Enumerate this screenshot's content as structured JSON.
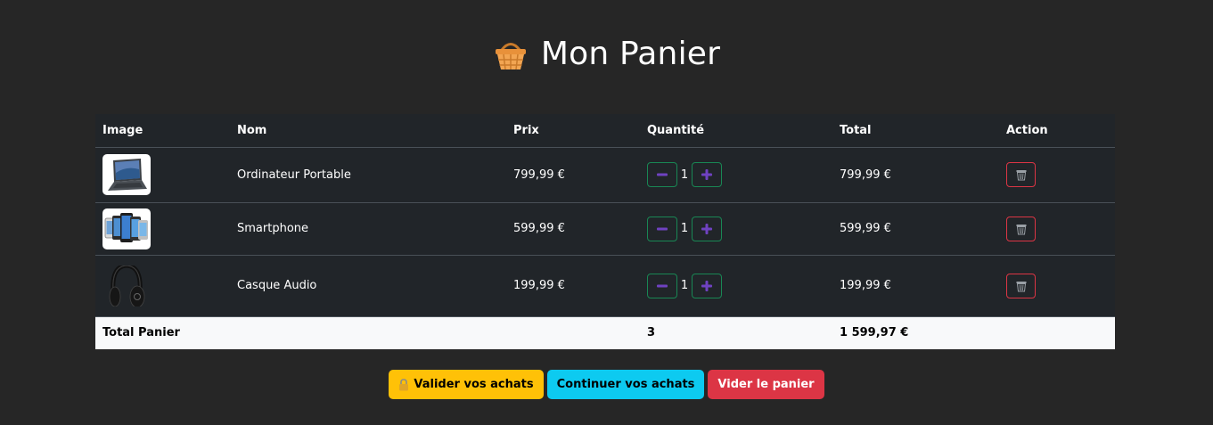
{
  "header": {
    "title": "Mon Panier",
    "icon": "basket-icon"
  },
  "table": {
    "columns": [
      "Image",
      "Nom",
      "Prix",
      "Quantité",
      "Total",
      "Action"
    ],
    "rows": [
      {
        "image": "laptop-image",
        "name": "Ordinateur Portable",
        "price": "799,99 €",
        "quantity": "1",
        "total": "799,99 €"
      },
      {
        "image": "smartphones-image",
        "name": "Smartphone",
        "price": "599,99 €",
        "quantity": "1",
        "total": "599,99 €"
      },
      {
        "image": "headphones-image",
        "name": "Casque Audio",
        "price": "199,99 €",
        "quantity": "1",
        "total": "199,99 €"
      }
    ],
    "footer": {
      "label": "Total Panier",
      "quantity": "3",
      "total": "1 599,97 €"
    }
  },
  "actions": {
    "validate": "Valider vos achats",
    "continue": "Continuer vos achats",
    "clear": "Vider le panier"
  },
  "colors": {
    "background": "#262626",
    "table": "#212529",
    "success": "#198754",
    "danger": "#dc3545",
    "warning": "#ffc107",
    "info": "#0dcaf0",
    "qty_icon": "#6f42c1"
  }
}
